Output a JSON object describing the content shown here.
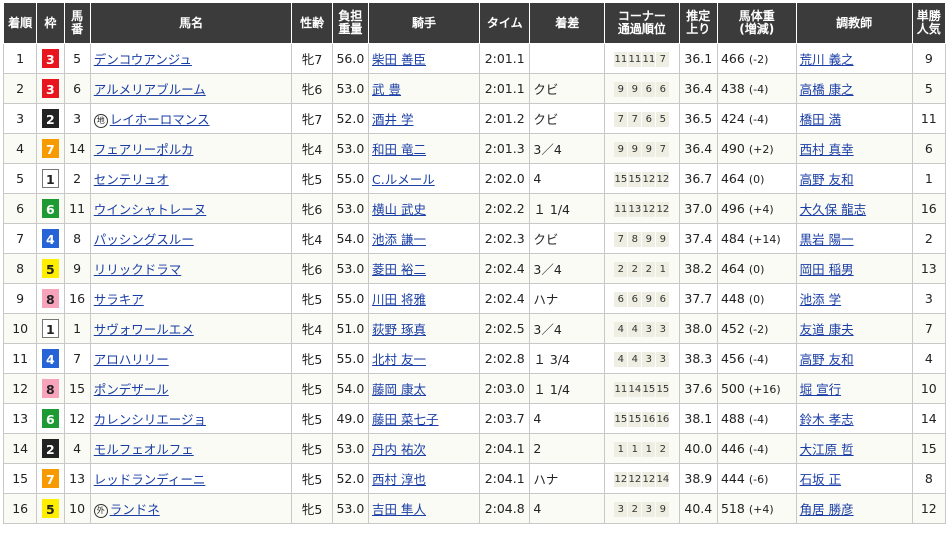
{
  "headers": [
    "着順",
    "枠",
    "馬番",
    "馬名",
    "性齢",
    "負担重量",
    "騎手",
    "タイム",
    "着差",
    "コーナー通過順位",
    "推定上り",
    "馬体重(増減)",
    "調教師",
    "単勝人気"
  ],
  "waku_colors": {
    "1": {
      "bg": "#ffffff",
      "fg": "#222222",
      "border": "#777777"
    },
    "2": {
      "bg": "#222222",
      "fg": "#ffffff",
      "border": "#222222"
    },
    "3": {
      "bg": "#e8141e",
      "fg": "#ffffff",
      "border": "#e8141e"
    },
    "4": {
      "bg": "#2563d6",
      "fg": "#ffffff",
      "border": "#2563d6"
    },
    "5": {
      "bg": "#ffee00",
      "fg": "#222222",
      "border": "#ffee00"
    },
    "6": {
      "bg": "#1e9a35",
      "fg": "#ffffff",
      "border": "#1e9a35"
    },
    "7": {
      "bg": "#f79a00",
      "fg": "#ffffff",
      "border": "#f79a00"
    },
    "8": {
      "bg": "#f7a3bb",
      "fg": "#222222",
      "border": "#f7a3bb"
    }
  },
  "rows": [
    {
      "rank": "1",
      "waku": "3",
      "num": "5",
      "mark": "",
      "horse": "デンコウアンジュ",
      "sexage": "牝7",
      "weight": "56.0",
      "jockey": "柴田 善臣",
      "time": "2:01.1",
      "margin": "",
      "corner": [
        "11",
        "11",
        "11",
        "7"
      ],
      "agari": "36.1",
      "body": "466",
      "body_diff": "(-2)",
      "trainer": "荒川 義之",
      "pop": "9"
    },
    {
      "rank": "2",
      "waku": "3",
      "num": "6",
      "mark": "",
      "horse": "アルメリアブルーム",
      "sexage": "牝6",
      "weight": "53.0",
      "jockey": "武 豊",
      "time": "2:01.1",
      "margin": "クビ",
      "corner": [
        "9",
        "9",
        "6",
        "6"
      ],
      "agari": "36.4",
      "body": "438",
      "body_diff": "(-4)",
      "trainer": "高橋 康之",
      "pop": "5"
    },
    {
      "rank": "3",
      "waku": "2",
      "num": "3",
      "mark": "地",
      "horse": "レイホーロマンス",
      "sexage": "牝7",
      "weight": "52.0",
      "jockey": "酒井 学",
      "time": "2:01.2",
      "margin": "クビ",
      "corner": [
        "7",
        "7",
        "6",
        "5"
      ],
      "agari": "36.5",
      "body": "424",
      "body_diff": "(-4)",
      "trainer": "橋田 満",
      "pop": "11"
    },
    {
      "rank": "4",
      "waku": "7",
      "num": "14",
      "mark": "",
      "horse": "フェアリーポルカ",
      "sexage": "牝4",
      "weight": "53.0",
      "jockey": "和田 竜二",
      "time": "2:01.3",
      "margin": "3／4",
      "corner": [
        "9",
        "9",
        "9",
        "7"
      ],
      "agari": "36.4",
      "body": "490",
      "body_diff": "(+2)",
      "trainer": "西村 真幸",
      "pop": "6"
    },
    {
      "rank": "5",
      "waku": "1",
      "num": "2",
      "mark": "",
      "horse": "センテリュオ",
      "sexage": "牝5",
      "weight": "55.0",
      "jockey": "C.ルメール",
      "time": "2:02.0",
      "margin": "4",
      "corner": [
        "15",
        "15",
        "12",
        "12"
      ],
      "agari": "36.7",
      "body": "464",
      "body_diff": "(0)",
      "trainer": "高野 友和",
      "pop": "1"
    },
    {
      "rank": "6",
      "waku": "6",
      "num": "11",
      "mark": "",
      "horse": "ウインシャトレーヌ",
      "sexage": "牝6",
      "weight": "53.0",
      "jockey": "横山 武史",
      "time": "2:02.2",
      "margin": "１ 1/4",
      "corner": [
        "11",
        "13",
        "12",
        "12"
      ],
      "agari": "37.0",
      "body": "496",
      "body_diff": "(+4)",
      "trainer": "大久保 龍志",
      "pop": "16"
    },
    {
      "rank": "7",
      "waku": "4",
      "num": "8",
      "mark": "",
      "horse": "パッシングスルー",
      "sexage": "牝4",
      "weight": "54.0",
      "jockey": "池添 謙一",
      "time": "2:02.3",
      "margin": "クビ",
      "corner": [
        "7",
        "8",
        "9",
        "9"
      ],
      "agari": "37.4",
      "body": "484",
      "body_diff": "(+14)",
      "trainer": "黒岩 陽一",
      "pop": "2"
    },
    {
      "rank": "8",
      "waku": "5",
      "num": "9",
      "mark": "",
      "horse": "リリックドラマ",
      "sexage": "牝6",
      "weight": "53.0",
      "jockey": "菱田 裕二",
      "time": "2:02.4",
      "margin": "3／4",
      "corner": [
        "2",
        "2",
        "2",
        "1"
      ],
      "agari": "38.2",
      "body": "464",
      "body_diff": "(0)",
      "trainer": "岡田 稲男",
      "pop": "13"
    },
    {
      "rank": "9",
      "waku": "8",
      "num": "16",
      "mark": "",
      "horse": "サラキア",
      "sexage": "牝5",
      "weight": "55.0",
      "jockey": "川田 将雅",
      "time": "2:02.4",
      "margin": "ハナ",
      "corner": [
        "6",
        "6",
        "9",
        "6"
      ],
      "agari": "37.7",
      "body": "448",
      "body_diff": "(0)",
      "trainer": "池添 学",
      "pop": "3"
    },
    {
      "rank": "10",
      "waku": "1",
      "num": "1",
      "mark": "",
      "horse": "サヴォワールエメ",
      "sexage": "牝4",
      "weight": "51.0",
      "jockey": "荻野 琢真",
      "time": "2:02.5",
      "margin": "3／4",
      "corner": [
        "4",
        "4",
        "3",
        "3"
      ],
      "agari": "38.0",
      "body": "452",
      "body_diff": "(-2)",
      "trainer": "友道 康夫",
      "pop": "7"
    },
    {
      "rank": "11",
      "waku": "4",
      "num": "7",
      "mark": "",
      "horse": "アロハリリー",
      "sexage": "牝5",
      "weight": "55.0",
      "jockey": "北村 友一",
      "time": "2:02.8",
      "margin": "１ 3/4",
      "corner": [
        "4",
        "4",
        "3",
        "3"
      ],
      "agari": "38.3",
      "body": "456",
      "body_diff": "(-4)",
      "trainer": "高野 友和",
      "pop": "4"
    },
    {
      "rank": "12",
      "waku": "8",
      "num": "15",
      "mark": "",
      "horse": "ポンデザール",
      "sexage": "牝5",
      "weight": "54.0",
      "jockey": "藤岡 康太",
      "time": "2:03.0",
      "margin": "１ 1/4",
      "corner": [
        "11",
        "14",
        "15",
        "15"
      ],
      "agari": "37.6",
      "body": "500",
      "body_diff": "(+16)",
      "trainer": "堀 宣行",
      "pop": "10"
    },
    {
      "rank": "13",
      "waku": "6",
      "num": "12",
      "mark": "",
      "horse": "カレンシリエージョ",
      "sexage": "牝5",
      "weight": "49.0",
      "jockey": "藤田 菜七子",
      "time": "2:03.7",
      "margin": "4",
      "corner": [
        "15",
        "15",
        "16",
        "16"
      ],
      "agari": "38.1",
      "body": "488",
      "body_diff": "(-4)",
      "trainer": "鈴木 孝志",
      "pop": "14"
    },
    {
      "rank": "14",
      "waku": "2",
      "num": "4",
      "mark": "",
      "horse": "モルフェオルフェ",
      "sexage": "牝5",
      "weight": "53.0",
      "jockey": "丹内 祐次",
      "time": "2:04.1",
      "margin": "2",
      "corner": [
        "1",
        "1",
        "1",
        "2"
      ],
      "agari": "40.0",
      "body": "446",
      "body_diff": "(-4)",
      "trainer": "大江原 哲",
      "pop": "15"
    },
    {
      "rank": "15",
      "waku": "7",
      "num": "13",
      "mark": "",
      "horse": "レッドランディーニ",
      "sexage": "牝5",
      "weight": "52.0",
      "jockey": "西村 淳也",
      "time": "2:04.1",
      "margin": "ハナ",
      "corner": [
        "12",
        "12",
        "12",
        "14"
      ],
      "agari": "38.9",
      "body": "444",
      "body_diff": "(-6)",
      "trainer": "石坂 正",
      "pop": "8"
    },
    {
      "rank": "16",
      "waku": "5",
      "num": "10",
      "mark": "外",
      "horse": "ランドネ",
      "sexage": "牝5",
      "weight": "53.0",
      "jockey": "吉田 隼人",
      "time": "2:04.8",
      "margin": "4",
      "corner": [
        "3",
        "2",
        "3",
        "9"
      ],
      "agari": "40.4",
      "body": "518",
      "body_diff": "(+4)",
      "trainer": "角居 勝彦",
      "pop": "12"
    }
  ]
}
